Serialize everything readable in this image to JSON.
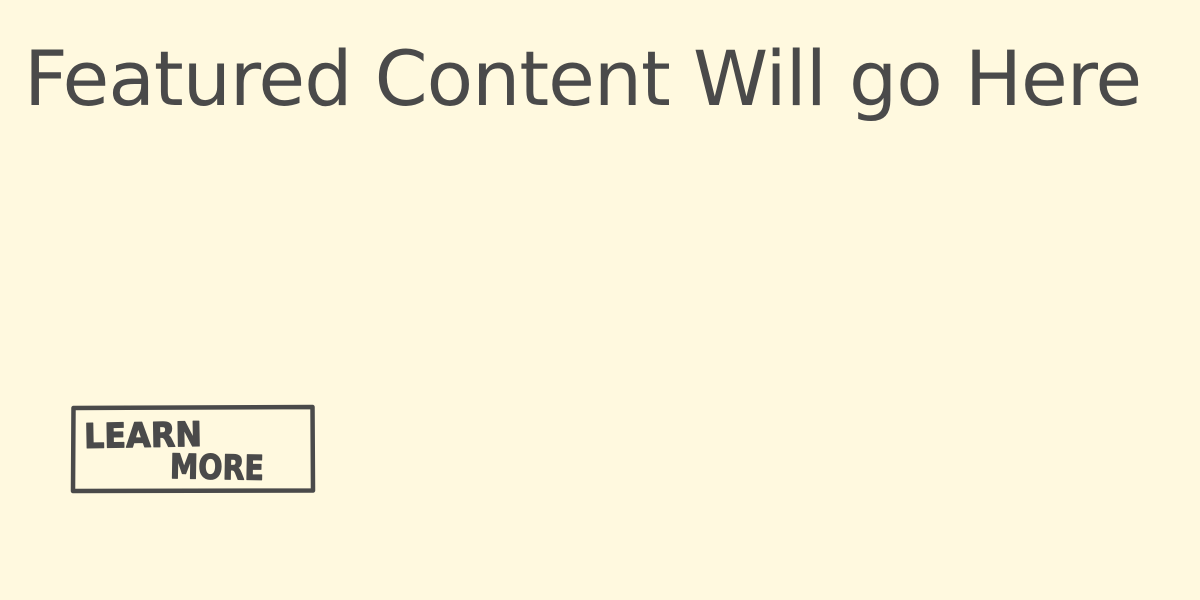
{
  "featured": {
    "headline": "Featured Content Will go Here"
  },
  "cta": {
    "line1": "LEARN",
    "line2": "MORE"
  },
  "colors": {
    "background": "#FFF9DF",
    "ink": "#4A4A4A"
  }
}
